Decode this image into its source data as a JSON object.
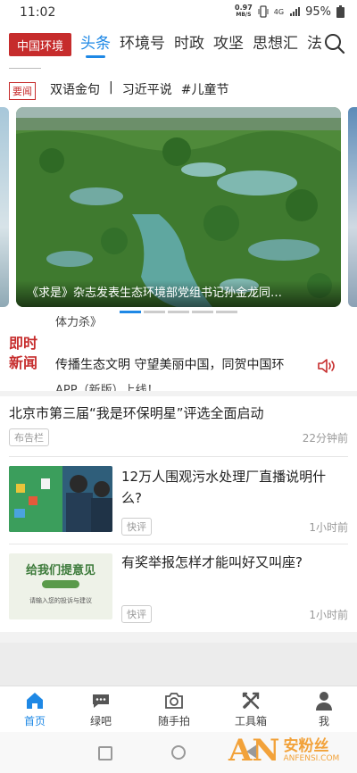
{
  "status": {
    "time": "11:02",
    "net_speed": "0.97",
    "net_unit": "MB/S",
    "network": "4G",
    "battery": "95%"
  },
  "nav": {
    "logo": "中国环境",
    "tabs": [
      "头条",
      "环境号",
      "时政",
      "攻坚",
      "思想汇",
      "法"
    ],
    "active_tab": "头条"
  },
  "headline": {
    "badge": "要闻",
    "items": [
      "双语金句",
      "|",
      "习近平说",
      "#儿童节"
    ]
  },
  "carousel": {
    "caption": "《求是》杂志发表生态环境部党组书记孙金龙同…",
    "page_count": 5,
    "active_index": 0
  },
  "flash": {
    "label_line1": "即时",
    "label_line2": "新闻",
    "top_text": "体力杀》",
    "main_text": "传播生态文明 守望美丽中国，同贺中国环",
    "bottom_text": "APP（新版）上线！"
  },
  "news": [
    {
      "title": "北京市第三届“我是环保明星”评选全面启动",
      "tag": "布告栏",
      "time": "22分钟前"
    },
    {
      "title": "12万人围观污水处理厂直播说明什么?",
      "tag": "快评",
      "time": "1小时前"
    },
    {
      "title": "有奖举报怎样才能叫好又叫座?",
      "tag": "快评",
      "time": "1小时前",
      "thumb_text": "给我们提意见",
      "thumb_sub": "请输入您的投诉与建议"
    }
  ],
  "bottom_nav": [
    {
      "label": "首页",
      "icon": "home-icon",
      "active": true
    },
    {
      "label": "绿吧",
      "icon": "chat-bubble-icon",
      "active": false
    },
    {
      "label": "随手拍",
      "icon": "camera-icon",
      "active": false
    },
    {
      "label": "工具箱",
      "icon": "tools-icon",
      "active": false
    },
    {
      "label": "我",
      "icon": "person-icon",
      "active": false
    }
  ],
  "watermark": {
    "logo": "AN",
    "cn": "安粉丝",
    "en": "ANFENSI.COM"
  }
}
